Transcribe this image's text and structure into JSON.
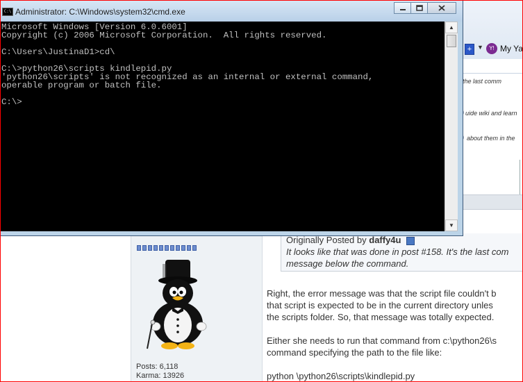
{
  "cmd_window": {
    "title": "Administrator: C:\\Windows\\system32\\cmd.exe",
    "icon": "C:\\",
    "buttons": {
      "minimize_icon": "minimize-icon",
      "maximize_icon": "maximize-icon",
      "close_icon": "close-icon"
    },
    "lines": [
      "Microsoft Windows [Version 6.0.6001]",
      "Copyright (c) 2006 Microsoft Corporation.  All rights reserved.",
      "",
      "C:\\Users\\JustinaD1>cd\\",
      "",
      "C:\\>python26\\scripts kindlepid.py",
      "'python26\\scripts' is not recognized as an internal or external command,",
      "operable program or batch file.",
      "",
      "C:\\>"
    ],
    "colors": {
      "console_bg": "#000000",
      "console_text": "#c0c0c0"
    }
  },
  "browser_bg": {
    "toolbar_plus": "+",
    "toolbar_caret": "▼",
    "my_label": "My Ya",
    "snippets": [
      "the last comm",
      "uide wiki and learn",
      "about them in the"
    ]
  },
  "post": {
    "quote_prefix": "Originally Posted by",
    "quote_author": "daffy4u",
    "quote_lines": [
      "It looks like that was done in post #158. It's the last com",
      "message below the command."
    ],
    "body_lines": [
      "Right, the error message was that the script file couldn't b",
      "that script is expected to be in the current directory unles",
      "the scripts folder. So, that message was totally expected.",
      "",
      "Either she needs to run that command from c:\\python26\\s",
      "command specifying the path to the file like:",
      "",
      "python \\python26\\scripts\\kindlepid.py"
    ],
    "user_stats": {
      "posts": "Posts: 6,118",
      "karma": "Karma: 13926"
    }
  }
}
